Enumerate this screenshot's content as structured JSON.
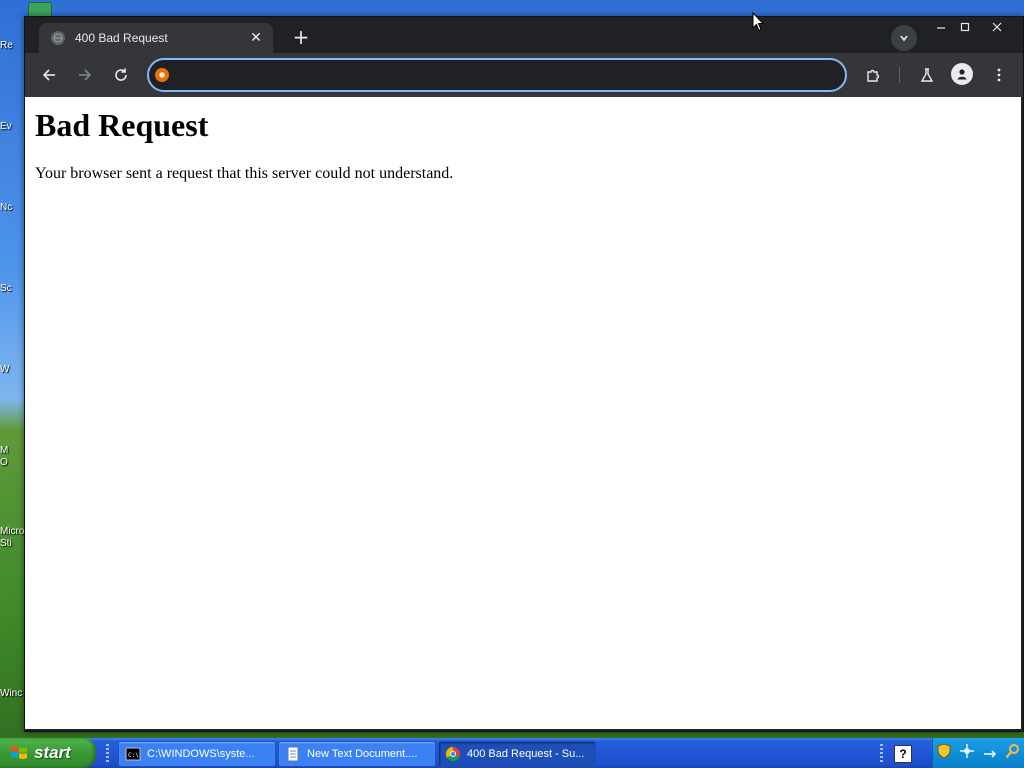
{
  "desktop": {
    "icon_labels": [
      "Re",
      "Ev",
      "Nc",
      "Sc",
      "W",
      "M",
      "O",
      "Micro",
      "Sti",
      "Winc"
    ]
  },
  "browser": {
    "tab": {
      "title": "400 Bad Request",
      "close_label": "✕"
    },
    "new_tab_label": "+",
    "omnibox": {
      "value": "",
      "placeholder": ""
    },
    "window_controls": {
      "minimize": "—",
      "maximize": "☐",
      "close": "✕"
    }
  },
  "page": {
    "heading": "Bad Request",
    "message": "Your browser sent a request that this server could not understand."
  },
  "taskbar": {
    "start_label": "start",
    "tasks": [
      {
        "label": "C:\\WINDOWS\\syste...",
        "icon": "cmd-icon",
        "active": false
      },
      {
        "label": "New Text Document....",
        "icon": "notepad-icon",
        "active": false
      },
      {
        "label": "400 Bad Request - Su...",
        "icon": "chrome-icon",
        "active": true
      }
    ],
    "help_label": "?"
  },
  "colors": {
    "chrome_dark": "#202124",
    "chrome_toolbar": "#35363a",
    "omnibox_focus": "#8ab4f8",
    "xp_taskbar": "#245edb",
    "xp_start_green": "#3a9a37",
    "xp_tray": "#108fd8"
  }
}
